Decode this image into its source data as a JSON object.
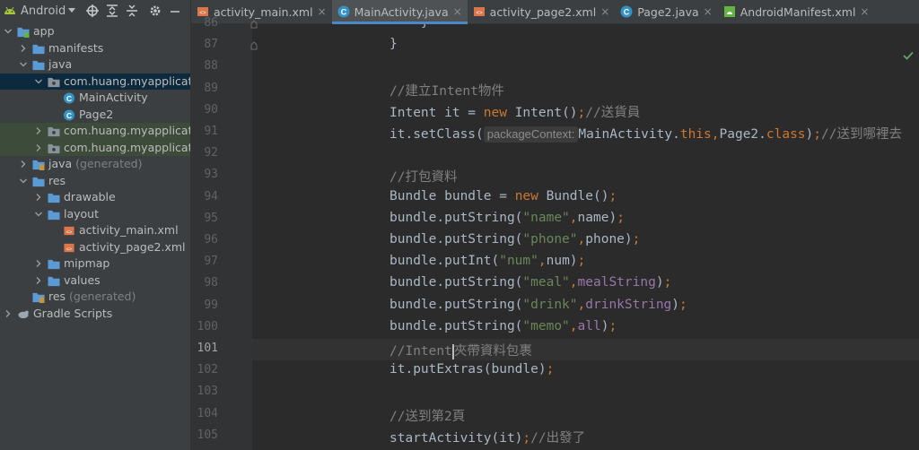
{
  "project_panel": {
    "view_mode": "Android",
    "tree": [
      {
        "label": "app",
        "depth": 0,
        "expanded": true,
        "icon": "module-folder-icon",
        "suffix": ""
      },
      {
        "label": "manifests",
        "depth": 1,
        "expanded": false,
        "icon": "folder-icon",
        "suffix": ""
      },
      {
        "label": "java",
        "depth": 1,
        "expanded": true,
        "icon": "folder-icon",
        "suffix": ""
      },
      {
        "label": "com.huang.myapplication",
        "depth": 2,
        "expanded": true,
        "icon": "package-icon",
        "suffix": "",
        "state": "selected"
      },
      {
        "label": "MainActivity",
        "depth": 3,
        "icon": "class-icon",
        "suffix": ""
      },
      {
        "label": "Page2",
        "depth": 3,
        "icon": "class-icon",
        "suffix": ""
      },
      {
        "label": "com.huang.myapplication",
        "depth": 2,
        "expanded": false,
        "icon": "package-icon",
        "suffix": "",
        "state": "highlight"
      },
      {
        "label": "com.huang.myapplication",
        "depth": 2,
        "expanded": false,
        "icon": "package-icon",
        "suffix": "",
        "state": "highlight"
      },
      {
        "label": "java",
        "depth": 1,
        "expanded": false,
        "icon": "generated-folder-icon",
        "suffix": "(generated)"
      },
      {
        "label": "res",
        "depth": 1,
        "expanded": true,
        "icon": "folder-icon",
        "suffix": ""
      },
      {
        "label": "drawable",
        "depth": 2,
        "expanded": false,
        "icon": "folder-icon",
        "suffix": ""
      },
      {
        "label": "layout",
        "depth": 2,
        "expanded": true,
        "icon": "folder-icon",
        "suffix": ""
      },
      {
        "label": "activity_main.xml",
        "depth": 3,
        "icon": "xml-layout-icon",
        "suffix": ""
      },
      {
        "label": "activity_page2.xml",
        "depth": 3,
        "icon": "xml-layout-icon",
        "suffix": ""
      },
      {
        "label": "mipmap",
        "depth": 2,
        "expanded": false,
        "icon": "folder-icon",
        "suffix": ""
      },
      {
        "label": "values",
        "depth": 2,
        "expanded": false,
        "icon": "folder-icon",
        "suffix": ""
      },
      {
        "label": "res",
        "depth": 1,
        "icon": "generated-folder-icon",
        "suffix": "(generated)"
      },
      {
        "label": "Gradle Scripts",
        "depth": 0,
        "expanded": false,
        "icon": "gradle-icon",
        "suffix": ""
      }
    ]
  },
  "tabs": [
    {
      "label": "activity_main.xml",
      "icon": "xml-layout-icon",
      "active": false
    },
    {
      "label": "MainActivity.java",
      "icon": "class-icon",
      "active": true
    },
    {
      "label": "activity_page2.xml",
      "icon": "xml-layout-icon",
      "active": false
    },
    {
      "label": "Page2.java",
      "icon": "class-icon",
      "active": false
    },
    {
      "label": "AndroidManifest.xml",
      "icon": "manifest-icon",
      "active": false
    }
  ],
  "editor": {
    "current_line": "101",
    "lines": [
      {
        "n": "86",
        "tokens": [
          {
            "t": "    }",
            "c": ""
          }
        ]
      },
      {
        "n": "87",
        "tokens": [
          {
            "t": "}",
            "c": ""
          }
        ]
      },
      {
        "n": "88",
        "tokens": []
      },
      {
        "n": "89",
        "tokens": [
          {
            "t": "//建立Intent物件",
            "c": "cm"
          }
        ]
      },
      {
        "n": "90",
        "tokens": [
          {
            "t": "Intent it = ",
            "c": ""
          },
          {
            "t": "new ",
            "c": "kw"
          },
          {
            "t": "Intent()",
            "c": ""
          },
          {
            "t": ";",
            "c": "kw"
          },
          {
            "t": "//送貨員",
            "c": "cm"
          }
        ]
      },
      {
        "n": "91",
        "tokens": [
          {
            "t": "it.setClass(",
            "c": ""
          },
          {
            "t": "packageContext:",
            "c": "hint"
          },
          {
            "t": "MainActivity.",
            "c": ""
          },
          {
            "t": "this",
            "c": "kw"
          },
          {
            "t": ",",
            "c": "kw"
          },
          {
            "t": "Page2.",
            "c": ""
          },
          {
            "t": "class",
            "c": "kw"
          },
          {
            "t": ")",
            "c": ""
          },
          {
            "t": ";",
            "c": "kw"
          },
          {
            "t": "//送到哪裡去",
            "c": "cm"
          }
        ]
      },
      {
        "n": "92",
        "tokens": []
      },
      {
        "n": "93",
        "tokens": [
          {
            "t": "//打包資料",
            "c": "cm"
          }
        ]
      },
      {
        "n": "94",
        "tokens": [
          {
            "t": "Bundle bundle = ",
            "c": ""
          },
          {
            "t": "new ",
            "c": "kw"
          },
          {
            "t": "Bundle()",
            "c": ""
          },
          {
            "t": ";",
            "c": "kw"
          }
        ]
      },
      {
        "n": "95",
        "tokens": [
          {
            "t": "bundle.putString(",
            "c": ""
          },
          {
            "t": "\"name\"",
            "c": "str"
          },
          {
            "t": ",",
            "c": "kw"
          },
          {
            "t": "name)",
            "c": ""
          },
          {
            "t": ";",
            "c": "kw"
          }
        ]
      },
      {
        "n": "96",
        "tokens": [
          {
            "t": "bundle.putString(",
            "c": ""
          },
          {
            "t": "\"phone\"",
            "c": "str"
          },
          {
            "t": ",",
            "c": "kw"
          },
          {
            "t": "phone)",
            "c": ""
          },
          {
            "t": ";",
            "c": "kw"
          }
        ]
      },
      {
        "n": "97",
        "tokens": [
          {
            "t": "bundle.putInt(",
            "c": ""
          },
          {
            "t": "\"num\"",
            "c": "str"
          },
          {
            "t": ",",
            "c": "kw"
          },
          {
            "t": "num)",
            "c": ""
          },
          {
            "t": ";",
            "c": "kw"
          }
        ]
      },
      {
        "n": "98",
        "tokens": [
          {
            "t": "bundle.putString(",
            "c": ""
          },
          {
            "t": "\"meal\"",
            "c": "str"
          },
          {
            "t": ",",
            "c": "kw"
          },
          {
            "t": "mealString",
            "c": "fld"
          },
          {
            "t": ")",
            "c": ""
          },
          {
            "t": ";",
            "c": "kw"
          }
        ]
      },
      {
        "n": "99",
        "tokens": [
          {
            "t": "bundle.putString(",
            "c": ""
          },
          {
            "t": "\"drink\"",
            "c": "str"
          },
          {
            "t": ",",
            "c": "kw"
          },
          {
            "t": "drinkString",
            "c": "fld"
          },
          {
            "t": ")",
            "c": ""
          },
          {
            "t": ";",
            "c": "kw"
          }
        ]
      },
      {
        "n": "100",
        "tokens": [
          {
            "t": "bundle.putString(",
            "c": ""
          },
          {
            "t": "\"memo\"",
            "c": "str"
          },
          {
            "t": ",",
            "c": "kw"
          },
          {
            "t": "all",
            "c": "fld"
          },
          {
            "t": ")",
            "c": ""
          },
          {
            "t": ";",
            "c": "kw"
          }
        ]
      },
      {
        "n": "101",
        "tokens": [
          {
            "t": "//Intent",
            "c": "cm"
          },
          {
            "t": "",
            "c": "caret"
          },
          {
            "t": "夾帶資料包裹",
            "c": "cm"
          }
        ]
      },
      {
        "n": "102",
        "tokens": [
          {
            "t": "it.putExtras(bundle)",
            "c": ""
          },
          {
            "t": ";",
            "c": "kw"
          }
        ]
      },
      {
        "n": "103",
        "tokens": []
      },
      {
        "n": "104",
        "tokens": [
          {
            "t": "//送到第2頁",
            "c": "cm"
          }
        ]
      },
      {
        "n": "105",
        "tokens": [
          {
            "t": "startActivity(it)",
            "c": ""
          },
          {
            "t": ";",
            "c": "kw"
          },
          {
            "t": "//出發了",
            "c": "cm"
          }
        ]
      }
    ]
  },
  "colors": {
    "keyword": "#cc7832",
    "string": "#6a8759",
    "comment": "#808080",
    "field": "#9876aa",
    "folder": "#5b9bd5",
    "class": "#3592c4",
    "xml": "#d9764a",
    "selection": "#0d293e",
    "accent": "#4a88c7"
  }
}
